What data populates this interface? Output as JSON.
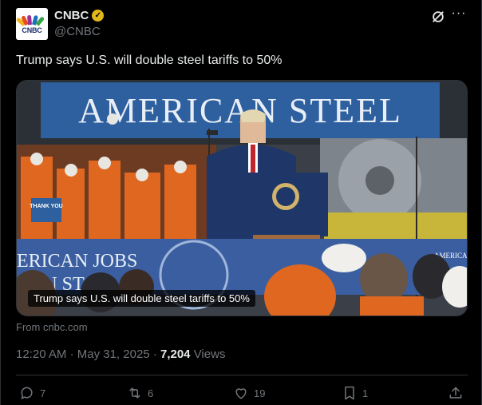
{
  "account": {
    "display_name": "CNBC",
    "handle": "@CNBC",
    "avatar_text": "CNBC",
    "verified": "gold-check"
  },
  "header": {
    "grok_icon": "grok-icon",
    "more_icon": "more-icon",
    "more_label": "···"
  },
  "tweet": {
    "text": "Trump says U.S. will double steel tariffs to 50%"
  },
  "media": {
    "caption": "Trump says U.S. will double steel tariffs to 50%",
    "banner_text": "AMERICAN STEEL",
    "lower_banner_text_1": "ERICAN JOBS",
    "lower_banner_text_2": "CAN ST",
    "right_sign_text": "AMERICAN",
    "crowd_sign_text": "THANK YOU"
  },
  "card": {
    "from_text": "From cnbc.com"
  },
  "meta": {
    "time": "12:20 AM",
    "separator": "·",
    "date": "May 31, 2025",
    "views_count": "7,204",
    "views_label": "Views"
  },
  "actions": {
    "replies": "7",
    "reposts": "6",
    "likes": "19",
    "bookmarks": "1"
  },
  "colors": {
    "background": "#000000",
    "text_primary": "#e7e9ea",
    "text_secondary": "#71767b",
    "border": "#2f3336",
    "verified_gold": "#e2b719"
  }
}
